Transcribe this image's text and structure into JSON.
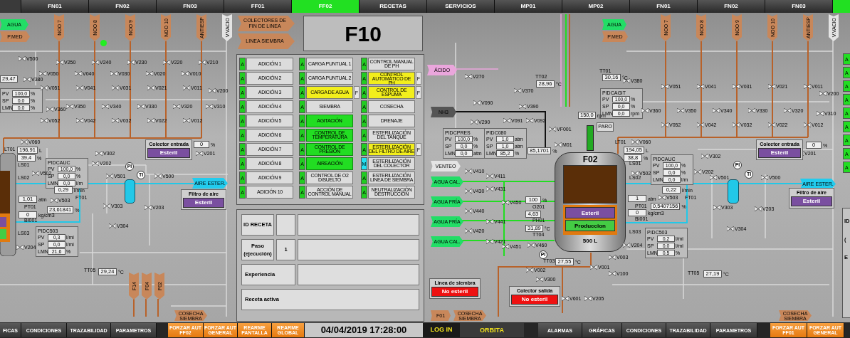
{
  "nav_tabs": [
    {
      "label": "FN01",
      "selected": false
    },
    {
      "label": "FN02",
      "selected": false
    },
    {
      "label": "FN03",
      "selected": false
    },
    {
      "label": "FF01",
      "selected": false
    },
    {
      "label": "FF02",
      "selected": true
    },
    {
      "label": "RECETAS",
      "selected": false
    },
    {
      "label": "SERVICIOS",
      "selected": false
    },
    {
      "label": "MP01",
      "selected": false
    },
    {
      "label": "MP02",
      "selected": false
    },
    {
      "label": "FN01",
      "selected": false
    },
    {
      "label": "FN02",
      "selected": false
    },
    {
      "label": "FN03",
      "selected": false
    }
  ],
  "left_schematic": {
    "side_tags": [
      {
        "text": "AGUA",
        "color": "#22dd66"
      },
      {
        "text": "P.MED",
        "color": "#c8875a"
      },
      {
        "text": "AIRE ESTER.",
        "color": "#22ccee"
      },
      {
        "text": "COSECHA SIEMBRA",
        "color": "#c8875a"
      }
    ],
    "vertical_tags": [
      {
        "text": "NOO 7",
        "color": "#c8875a"
      },
      {
        "text": "NOO 8",
        "color": "#c8875a"
      },
      {
        "text": "NOO 9",
        "color": "#c8875a"
      },
      {
        "text": "NOO 10",
        "color": "#c8875a"
      },
      {
        "text": "ANTIESP",
        "color": "#c8875a"
      },
      {
        "text": "V.VACIO",
        "color": "#e4e4e4"
      },
      {
        "text": "F14",
        "color": "#c8875a"
      },
      {
        "text": "F04",
        "color": "#c8875a"
      },
      {
        "text": "F02",
        "color": "#c8875a"
      }
    ],
    "valves": [
      "V500",
      "V380",
      "V050",
      "V250",
      "V040",
      "V240",
      "V030",
      "V230",
      "V020",
      "V220",
      "V010",
      "V210",
      "V051",
      "V041",
      "V031",
      "V021",
      "V011",
      "V200",
      "V360",
      "V350",
      "V340",
      "V330",
      "V320",
      "V310",
      "V052",
      "V042",
      "V032",
      "V022",
      "V012",
      "V060",
      "V202",
      "V302",
      "V201",
      "V502",
      "V501",
      "V500",
      "V503",
      "V303",
      "V203",
      "V304",
      "V204"
    ],
    "sensors": [
      "LT01",
      "LS01",
      "LS02",
      "FT01",
      "PT01",
      "BI001",
      "LS03",
      "TT05"
    ],
    "readings": [
      {
        "value": "29,47"
      },
      {
        "value": "196,91",
        "unit": "L"
      },
      {
        "value": "39,4",
        "unit": "%"
      },
      {
        "value": "0,29",
        "unit": "l/min"
      },
      {
        "value": "1,01",
        "unit": "atm"
      },
      {
        "value": "23,61841",
        "unit": "%"
      },
      {
        "value": "0",
        "unit": "kg/cm3"
      },
      {
        "value": "29,24",
        "unit": "°C"
      },
      {
        "value": "0",
        "unit": "%"
      }
    ],
    "controllers": [
      {
        "rows": [
          {
            "label": "PV",
            "value": "100,0",
            "unit": "%"
          },
          {
            "label": "SP",
            "value": "0,0",
            "unit": "%"
          },
          {
            "label": "LMN",
            "value": "0,0",
            "unit": "%"
          }
        ]
      },
      {
        "name": "PIDCAUC",
        "rows": [
          {
            "label": "PV",
            "value": "100,0",
            "unit": "%"
          },
          {
            "label": "SP",
            "value": "0,0",
            "unit": "%"
          },
          {
            "label": "LMN",
            "value": "0,0",
            "unit": "l/m"
          }
        ]
      },
      {
        "name": "PIDC503",
        "rows": [
          {
            "label": "PV",
            "value": "0,3",
            "unit": "l/mi"
          },
          {
            "label": "SP",
            "value": "0,0",
            "unit": "l/mi"
          },
          {
            "label": "LMN",
            "value": "21,6",
            "unit": "%"
          }
        ]
      }
    ],
    "panels": [
      {
        "title": "Colector entrada",
        "state": "Esteril",
        "kind": "sterile"
      },
      {
        "title": "Filtro de aire",
        "state": "Esteril",
        "kind": "sterile"
      }
    ],
    "instruments": [
      "PI",
      "TI"
    ]
  },
  "center": {
    "links": [
      "COLECTORES DE FIN DE LINEA",
      "LINEA SIEMBRA"
    ],
    "title": "F10",
    "columns": [
      [
        {
          "mode": "A",
          "label": "ADICIÓN 1",
          "running": false,
          "forced": false
        },
        {
          "mode": "A",
          "label": "ADICIÓN 2",
          "running": false,
          "forced": false
        },
        {
          "mode": "A",
          "label": "ADICIÓN 3",
          "running": false,
          "forced": false
        },
        {
          "mode": "A",
          "label": "ADICIÓN 4",
          "running": false,
          "forced": false
        },
        {
          "mode": "A",
          "label": "ADICIÓN 5",
          "running": false,
          "forced": false
        },
        {
          "mode": "A",
          "label": "ADICIÓN 6",
          "running": false,
          "forced": false
        },
        {
          "mode": "A",
          "label": "ADICIÓN 7",
          "running": false,
          "forced": false
        },
        {
          "mode": "A",
          "label": "ADICIÓN 8",
          "running": false,
          "forced": false
        },
        {
          "mode": "A",
          "label": "ADICIÓN 9",
          "running": false,
          "forced": false
        },
        {
          "mode": "A",
          "label": "ADICIÓN 10",
          "running": false,
          "forced": false
        }
      ],
      [
        {
          "mode": "A",
          "label": "CARGA PUNTUAL 1",
          "running": false,
          "forced": false
        },
        {
          "mode": "A",
          "label": "CARGA PUNTUAL 2",
          "running": false,
          "forced": false
        },
        {
          "mode": "A",
          "label": "CARGA DE AGUA",
          "running": false,
          "forced": true,
          "flag": "F"
        },
        {
          "mode": "A",
          "label": "SIEMBRA",
          "running": false,
          "forced": false
        },
        {
          "mode": "A",
          "label": "AGITACIÓN",
          "running": true,
          "forced": false
        },
        {
          "mode": "A",
          "label": "CONTROL DE TEMPERATURA",
          "running": true,
          "forced": false
        },
        {
          "mode": "A",
          "label": "CONTROL DE PRESIÓN",
          "running": true,
          "forced": false
        },
        {
          "mode": "A",
          "label": "AIREACIÓN",
          "running": true,
          "forced": false
        },
        {
          "mode": "A",
          "label": "CONTROL DE O2 DISUELTO",
          "running": false,
          "forced": false
        },
        {
          "mode": "A",
          "label": "ACCIÓN DE CONTROL MANUAL",
          "running": false,
          "forced": false
        }
      ],
      [
        {
          "mode": "A",
          "label": "CONTROL MANUAL DE PH",
          "running": false,
          "forced": false
        },
        {
          "mode": "A",
          "label": "CONTROL AUTOMÁTICO DE PH",
          "running": false,
          "forced": true,
          "flag": "F"
        },
        {
          "mode": "A",
          "label": "CONTROL DE ESPUMA",
          "running": false,
          "forced": true,
          "flag": "F"
        },
        {
          "mode": "A",
          "label": "COSECHA",
          "running": false,
          "forced": false
        },
        {
          "mode": "A",
          "label": "DRENAJE",
          "running": false,
          "forced": false
        },
        {
          "mode": "A",
          "label": "ESTERILIZACIÓN DEL TANQUE",
          "running": false,
          "forced": false
        },
        {
          "mode": "A",
          "label": "ESTERILIZACIÓN DEL FILTRO DE AIRE",
          "running": false,
          "forced": true,
          "flag": "F"
        },
        {
          "mode": "M",
          "label": "ESTERILIZACIÓN DEL COLECTOR",
          "running": false,
          "forced": false
        },
        {
          "mode": "A",
          "label": "ESTERILIZACIÓN LINEA DE SIEMBRA",
          "running": false,
          "forced": false
        },
        {
          "mode": "A",
          "label": "NEUTRALIZACIÓN DESTRUCCIÓN",
          "running": false,
          "forced": false
        }
      ]
    ],
    "recipe": {
      "id_label": "ID RECETA",
      "step_label": "Paso (ejecución)",
      "step_value": "1",
      "experience_label": "Experiencia",
      "active_label": "Receta activa"
    }
  },
  "right_schematic": {
    "side_tags": [
      {
        "text": "ÁCIDO",
        "color": "#eaa6dc"
      },
      {
        "text": "NH3",
        "color": "#555555"
      },
      {
        "text": "VENTEO",
        "color": "#e4e4e4"
      },
      {
        "text": "AGUA CAL.",
        "color": "#22dd66"
      },
      {
        "text": "AGUA FRÍA",
        "color": "#22dd66"
      },
      {
        "text": "AGUA FRÍA",
        "color": "#22dd66"
      },
      {
        "text": "AGUA CAL.",
        "color": "#22dd66"
      },
      {
        "text": "AGUA",
        "color": "#22dd66"
      },
      {
        "text": "P.MED",
        "color": "#c8875a"
      },
      {
        "text": "AIRE ESTER.",
        "color": "#22ccee"
      },
      {
        "text": "F01",
        "color": "#c8875a"
      },
      {
        "text": "COSECHA SIEMBRA",
        "color": "#c8875a"
      },
      {
        "text": "COSECHA SIEMBRA",
        "color": "#c8875a"
      }
    ],
    "vertical_tags": [
      {
        "text": "NOO 7",
        "color": "#c8875a"
      },
      {
        "text": "NOO 8",
        "color": "#c8875a"
      },
      {
        "text": "NOO 9",
        "color": "#c8875a"
      },
      {
        "text": "NOO 10",
        "color": "#c8875a"
      },
      {
        "text": "ANTIESP",
        "color": "#c8875a"
      },
      {
        "text": "V.VACIO",
        "color": "#e4e4e4"
      }
    ],
    "valves": [
      "V270",
      "V090",
      "V290",
      "V091",
      "V092",
      "V370",
      "V390",
      "V380",
      "V360",
      "V350",
      "V340",
      "V330",
      "V320",
      "V310",
      "V051",
      "V041",
      "V031",
      "V021",
      "V011",
      "V052",
      "V042",
      "V032",
      "V022",
      "V012",
      "V200",
      "V060",
      "V202",
      "V302",
      "V201",
      "V502",
      "V501",
      "V500",
      "V503",
      "V303",
      "V203",
      "V304",
      "V204",
      "V410",
      "V411",
      "V430",
      "V431",
      "V440",
      "V441",
      "V420",
      "V421",
      "V450",
      "V451",
      "V460",
      "V002",
      "V300",
      "V001",
      "V003",
      "V100",
      "V601",
      "V205",
      "VF001",
      "M01"
    ],
    "sensors": [
      "TT02",
      "TT01",
      "LT01",
      "LS01",
      "LS02",
      "LS03",
      "O201",
      "PH01",
      "TT04",
      "PT01",
      "BI001",
      "FT01",
      "TT03",
      "TT05"
    ],
    "readings": [
      {
        "value": "28,96",
        "unit": "°C"
      },
      {
        "value": "30,16",
        "unit": "°C"
      },
      {
        "value": "150,0",
        "unit": "rpm"
      },
      {
        "value": "85,1701",
        "unit": "%"
      },
      {
        "value": "194,05",
        "unit": "L"
      },
      {
        "value": "38,8",
        "unit": "%"
      },
      {
        "value": "100",
        "unit": "%"
      },
      {
        "value": "4,63"
      },
      {
        "value": "31,89",
        "unit": "°C"
      },
      {
        "value": "1",
        "unit": "atm"
      },
      {
        "value": "0",
        "unit": "kg/cm3"
      },
      {
        "value": "0,22",
        "unit": "l/min"
      },
      {
        "value": "0,5407156",
        "unit": "%"
      },
      {
        "value": "27,55",
        "unit": "°C"
      },
      {
        "value": "27,19",
        "unit": "°C"
      },
      {
        "value": "0",
        "unit": "%"
      }
    ],
    "controllers": [
      {
        "name": "PIDCPRES",
        "rows": [
          {
            "label": "PV",
            "value": "100,0",
            "unit": "%"
          },
          {
            "label": "SP",
            "value": "0,0",
            "unit": "%"
          },
          {
            "label": "LMN",
            "value": "0,0",
            "unit": "atm"
          }
        ]
      },
      {
        "name": "PIDC080",
        "rows": [
          {
            "label": "PV",
            "value": "1,0",
            "unit": "atm"
          },
          {
            "label": "SP",
            "value": "1,0",
            "unit": "atm"
          },
          {
            "label": "LMN",
            "value": "85,2",
            "unit": "%"
          }
        ]
      },
      {
        "name": "PIDCAGIT",
        "rows": [
          {
            "label": "PV",
            "value": "100,0",
            "unit": "%"
          },
          {
            "label": "SP",
            "value": "0,0",
            "unit": "%"
          },
          {
            "label": "LMN",
            "value": "0,0",
            "unit": "rpm"
          }
        ]
      },
      {
        "name": "PIDCAUC",
        "rows": [
          {
            "label": "PV",
            "value": "100,0",
            "unit": "%"
          },
          {
            "label": "SP",
            "value": "0,0",
            "unit": "%"
          },
          {
            "label": "LMN",
            "value": "0,0",
            "unit": "l/m"
          }
        ]
      },
      {
        "name": "PIDC503",
        "rows": [
          {
            "label": "PV",
            "value": "0,2",
            "unit": "l/mi"
          },
          {
            "label": "SP",
            "value": "0,0",
            "unit": "l/mi"
          },
          {
            "label": "LMN",
            "value": "0,5",
            "unit": "%"
          }
        ]
      }
    ],
    "panels": [
      {
        "title": "Colector entrada",
        "state": "Esteril",
        "kind": "sterile"
      },
      {
        "title": "Filtro de aire",
        "state": "Esteril",
        "kind": "sterile"
      },
      {
        "title": "Linea de siembra",
        "state": "No esteril",
        "kind": "not_sterile"
      },
      {
        "title": "Colector salida",
        "state": "No esteril",
        "kind": "not_sterile"
      }
    ],
    "instruments": [
      "PI",
      "TI",
      "PI"
    ],
    "buttons": [
      "PARO"
    ],
    "tank": {
      "name": "F02",
      "states": [
        {
          "text": "Esteril",
          "kind": "sterile"
        },
        {
          "text": "Produccion",
          "kind": "production"
        }
      ],
      "capacity": "500 L"
    },
    "edge_indicators": [
      "A",
      "A",
      "A",
      "A",
      "A",
      "A",
      "A",
      "A",
      "A"
    ],
    "edge_texts": [
      "ID",
      "(",
      "E"
    ]
  },
  "bottom_bar": {
    "left_buttons": [
      {
        "label": "FICAS",
        "kind": "gray"
      },
      {
        "label": "CONDICIONES",
        "kind": "gray"
      },
      {
        "label": "TRAZABILIDAD",
        "kind": "gray"
      },
      {
        "label": "PARAMETROS",
        "kind": "gray"
      },
      {
        "label": "FORZAR AUT FF02",
        "kind": "orange"
      },
      {
        "label": "FORZAR AUT GENERAL",
        "kind": "orange"
      },
      {
        "label": "REARME PANTALLA",
        "kind": "orange"
      },
      {
        "label": "REARME GLOBAL",
        "kind": "orange"
      }
    ],
    "datetime": "04/04/2019 17:28:00",
    "login": "LOG IN",
    "user": "ORBITA",
    "right_buttons": [
      {
        "label": "ALARMAS",
        "kind": "gray"
      },
      {
        "label": "GRÁFICAS",
        "kind": "gray"
      },
      {
        "label": "CONDICIONES",
        "kind": "gray"
      },
      {
        "label": "TRAZABILIDAD",
        "kind": "gray"
      },
      {
        "label": "PARAMETROS",
        "kind": "gray"
      },
      {
        "label": "FORZAR AUT FF01",
        "kind": "orange"
      },
      {
        "label": "FORZAR AUT GENERAL",
        "kind": "orange"
      }
    ]
  }
}
